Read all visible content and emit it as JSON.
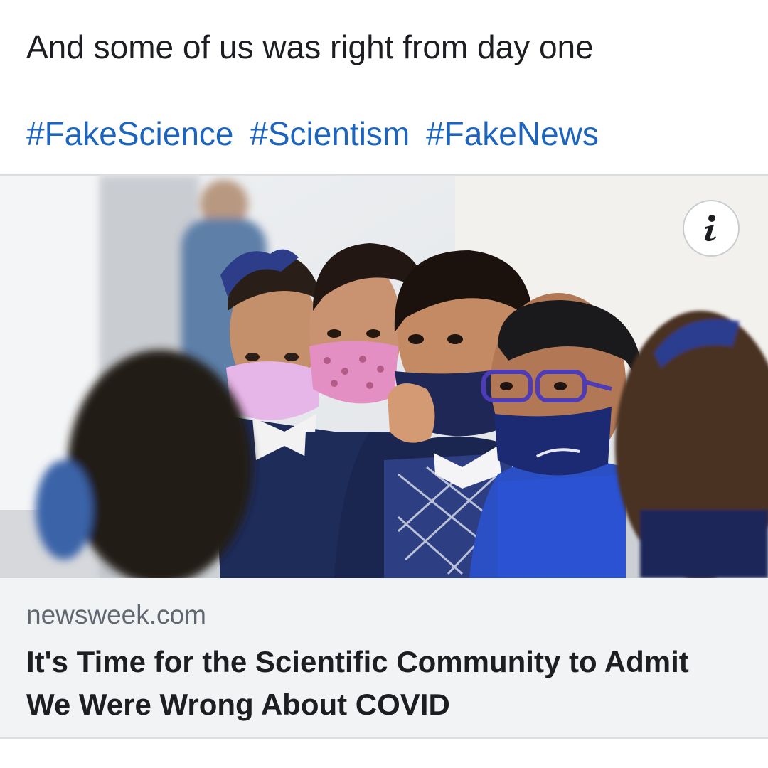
{
  "post": {
    "text": "And some of us was right from day one",
    "hashtags": [
      "#FakeScience",
      "#Scientism",
      "#FakeNews"
    ]
  },
  "link_preview": {
    "domain": "newsweek.com",
    "title_line1": "It's Time for the Scientific Community to Admit",
    "title_line2": "We Were Wrong About COVID",
    "image_icon": "info-icon"
  },
  "colors": {
    "hashtag": "#1d64bf",
    "text": "#1c1e21",
    "meta_bg": "#f2f3f5",
    "domain": "#606770"
  }
}
